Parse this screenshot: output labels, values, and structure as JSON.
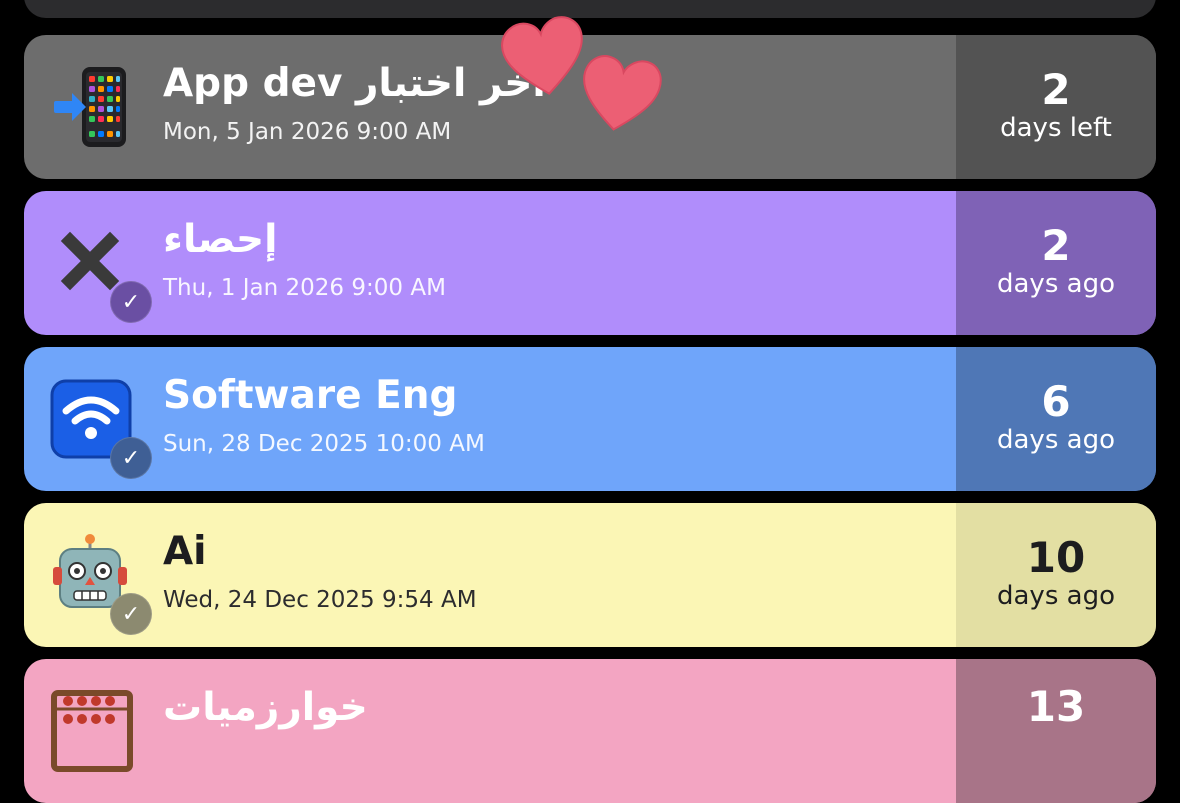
{
  "events": [
    {
      "id": "app-dev",
      "title": "آخر اختبار App dev",
      "date": "Mon, 5 Jan 2026 9:00 AM",
      "count": "2",
      "unit": "days left",
      "icon": "mobile-phone-arrow-icon",
      "completed": false,
      "colors": {
        "main": "#6d6d6d",
        "side": "#535353"
      }
    },
    {
      "id": "statistics",
      "title": "إحصاء",
      "date": "Thu, 1 Jan 2026 9:00 AM",
      "count": "2",
      "unit": "days ago",
      "icon": "cross-mark-icon",
      "completed": true,
      "colors": {
        "main": "#b08dfb",
        "side": "#7f62b6",
        "badge": "#6a4fa3"
      }
    },
    {
      "id": "software-eng",
      "title": "Software Eng",
      "date": "Sun, 28 Dec 2025 10:00 AM",
      "count": "6",
      "unit": "days ago",
      "icon": "wifi-icon",
      "completed": true,
      "colors": {
        "main": "#6fa5fa",
        "side": "#4f77b6",
        "badge": "#3f5f95"
      }
    },
    {
      "id": "ai",
      "title": "Ai",
      "date": "Wed, 24 Dec 2025 9:54 AM",
      "count": "10",
      "unit": "days ago",
      "icon": "robot-icon",
      "completed": true,
      "colors": {
        "main": "#fbf6b5",
        "side": "#e3dfa3",
        "badge": "#8c8a70"
      }
    },
    {
      "id": "algorithms",
      "title": "خوارزميات",
      "date": "",
      "count": "13",
      "unit": "",
      "icon": "abacus-icon",
      "completed": false,
      "colors": {
        "main": "#f3a5c2",
        "side": "#a87488"
      }
    }
  ],
  "decorations": {
    "heart_color": "#ec5f74",
    "heart_icon": "heart-sticker-icon"
  }
}
